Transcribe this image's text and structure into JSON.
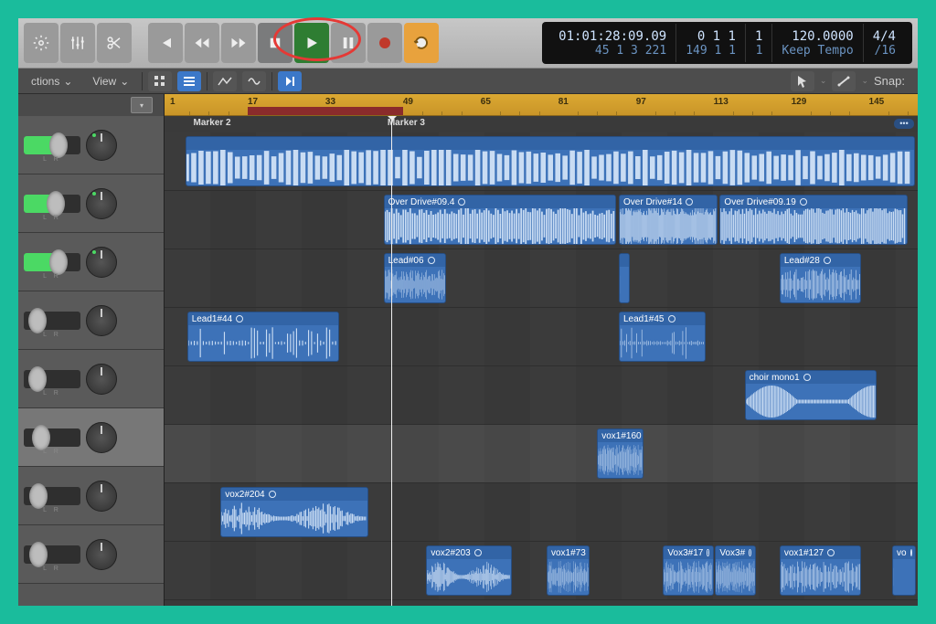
{
  "lcd": {
    "pos_top": "01:01:28:09.09",
    "pos_bot": "45 1 3 221",
    "bars_top": "0 1 1",
    "bars_bot": "149 1 1",
    "beats_top": "1",
    "beats_bot": "1",
    "tempo_top": "120.0000",
    "tempo_bot": "Keep Tempo",
    "sig_top": "4/4",
    "sig_bot": "/16"
  },
  "secbar": {
    "menu_functions": "ctions",
    "menu_view": "View",
    "snap": "Snap:"
  },
  "ruler": {
    "ticks": [
      1,
      17,
      33,
      49,
      65,
      81,
      97,
      113,
      129,
      145
    ]
  },
  "cycle_bar": {
    "start_tick_index": 1,
    "end_tick_index": 3
  },
  "markers": [
    {
      "label": "Marker 2",
      "tick_index": 0.3
    },
    {
      "label": "Marker 3",
      "tick_index": 2.8
    }
  ],
  "playhead_tick": 2.85,
  "tracks": [
    {
      "level": 0.55,
      "pan": "right",
      "selected": false
    },
    {
      "level": 0.5,
      "pan": "right",
      "selected": false
    },
    {
      "level": 0.55,
      "pan": "left",
      "selected": false
    },
    {
      "level": 0.1,
      "pan": "center",
      "selected": false
    },
    {
      "level": 0.1,
      "pan": "center",
      "selected": false
    },
    {
      "level": 0.18,
      "pan": "center",
      "selected": true
    },
    {
      "level": 0.12,
      "pan": "center",
      "selected": false
    },
    {
      "level": 0.12,
      "pan": "center",
      "selected": false
    }
  ],
  "regions": [
    {
      "lane": 0,
      "label": "",
      "start": 0.2,
      "end": 9.6,
      "wave": "dense"
    },
    {
      "lane": 1,
      "label": "Over Drive#09.4",
      "start": 2.75,
      "end": 5.75,
      "wave": "dense"
    },
    {
      "lane": 1,
      "label": "Over Drive#14",
      "start": 5.78,
      "end": 7.05,
      "wave": "dense"
    },
    {
      "lane": 1,
      "label": "Over Drive#09.19",
      "start": 7.08,
      "end": 9.5,
      "wave": "dense"
    },
    {
      "lane": 2,
      "label": "Lead#06",
      "start": 2.75,
      "end": 3.55,
      "wave": "mid"
    },
    {
      "lane": 2,
      "label": "",
      "start": 5.78,
      "end": 5.92,
      "wave": "bar"
    },
    {
      "lane": 2,
      "label": "Lead#28",
      "start": 7.85,
      "end": 8.9,
      "wave": "mid"
    },
    {
      "lane": 3,
      "label": "Lead1#44",
      "start": 0.22,
      "end": 2.18,
      "wave": "sparse"
    },
    {
      "lane": 3,
      "label": "Lead1#45",
      "start": 5.78,
      "end": 6.9,
      "wave": "sparse"
    },
    {
      "lane": 4,
      "label": "choir mono1",
      "start": 7.4,
      "end": 9.1,
      "wave": "blobs"
    },
    {
      "lane": 5,
      "label": "vox1#160",
      "start": 5.5,
      "end": 6.1,
      "wave": "mid"
    },
    {
      "lane": 6,
      "label": "vox2#204",
      "start": 0.65,
      "end": 2.55,
      "wave": "voices"
    },
    {
      "lane": 7,
      "label": "vox2#203",
      "start": 3.3,
      "end": 4.4,
      "wave": "voices"
    },
    {
      "lane": 7,
      "label": "vox1#73",
      "start": 4.85,
      "end": 5.4,
      "wave": "mid"
    },
    {
      "lane": 7,
      "label": "Vox3#17",
      "start": 6.35,
      "end": 7.0,
      "wave": "mid"
    },
    {
      "lane": 7,
      "label": "Vox3#",
      "start": 7.02,
      "end": 7.55,
      "wave": "mid"
    },
    {
      "lane": 7,
      "label": "vox1#127",
      "start": 7.85,
      "end": 8.9,
      "wave": "mid"
    },
    {
      "lane": 7,
      "label": "vo",
      "start": 9.3,
      "end": 9.6,
      "wave": "bar"
    }
  ]
}
